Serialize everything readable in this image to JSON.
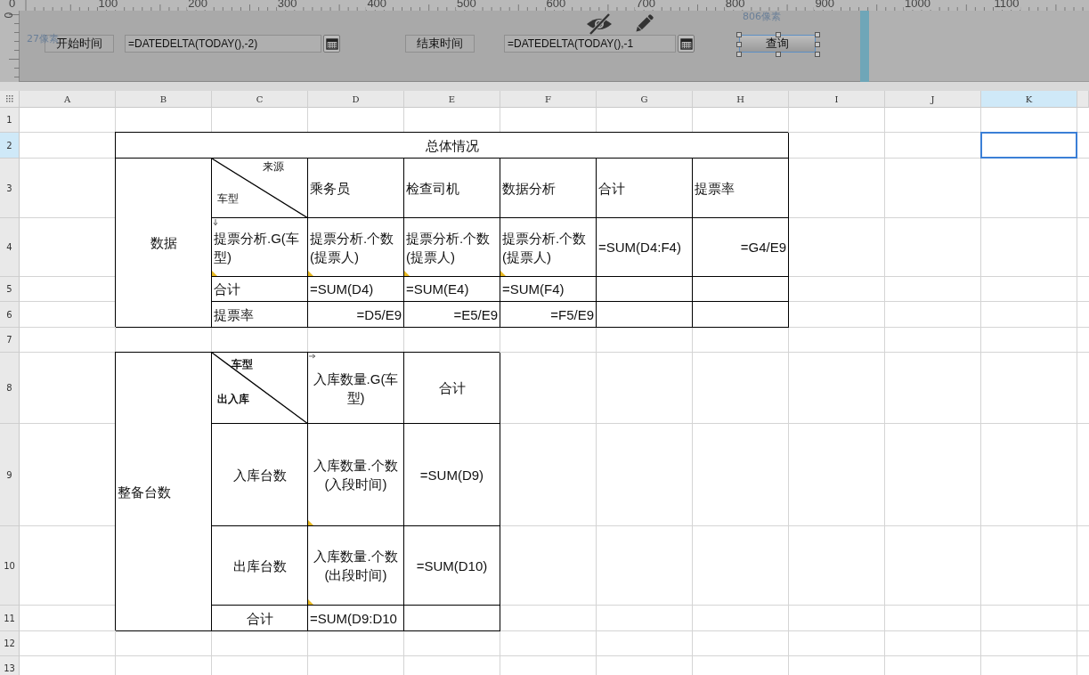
{
  "ruler": {
    "top_marks": [
      "0",
      "100",
      "200",
      "300",
      "400",
      "500",
      "600",
      "700",
      "800",
      "900",
      "1000",
      "1100"
    ],
    "left_mark": "0"
  },
  "parameter_panel": {
    "hints": [
      "27像素",
      "806像素"
    ],
    "widgets": [
      {
        "kind": "label",
        "text": "开始时间"
      },
      {
        "kind": "date",
        "value": "=DATEDELTA(TODAY(),-2)"
      },
      {
        "kind": "label",
        "text": "结束时间"
      },
      {
        "kind": "date",
        "value": "=DATEDELTA(TODAY(),-1"
      },
      {
        "kind": "button",
        "text": "查询",
        "selected": true
      }
    ]
  },
  "sheet": {
    "columns": [
      {
        "label": "A",
        "selected": false
      },
      {
        "label": "B",
        "selected": false
      },
      {
        "label": "C",
        "selected": false
      },
      {
        "label": "D",
        "selected": false
      },
      {
        "label": "E",
        "selected": false
      },
      {
        "label": "F",
        "selected": false
      },
      {
        "label": "G",
        "selected": false
      },
      {
        "label": "H",
        "selected": false
      },
      {
        "label": "I",
        "selected": false
      },
      {
        "label": "J",
        "selected": false
      },
      {
        "label": "K",
        "selected": true
      }
    ],
    "rows": [
      {
        "label": "1",
        "selected": false
      },
      {
        "label": "2",
        "selected": true
      },
      {
        "label": "3",
        "selected": false
      },
      {
        "label": "4",
        "selected": false
      },
      {
        "label": "5",
        "selected": false
      },
      {
        "label": "6",
        "selected": false
      },
      {
        "label": "7",
        "selected": false
      },
      {
        "label": "8",
        "selected": false
      },
      {
        "label": "9",
        "selected": false
      },
      {
        "label": "10",
        "selected": false
      },
      {
        "label": "11",
        "selected": false
      },
      {
        "label": "12",
        "selected": false
      },
      {
        "label": "13",
        "selected": false
      }
    ],
    "cells": [
      {
        "kind": "text",
        "text": "总体情况"
      },
      {
        "kind": "text",
        "text": "数据"
      },
      {
        "kind": "diagonal",
        "top": "来源",
        "bottom": "车型",
        "bold": false
      },
      {
        "kind": "text",
        "text": "乘务员"
      },
      {
        "kind": "text",
        "text": "检查司机"
      },
      {
        "kind": "text",
        "text": "数据分析"
      },
      {
        "kind": "text",
        "text": "合计"
      },
      {
        "kind": "text",
        "text": "提票率"
      },
      {
        "kind": "text",
        "text": "提票分析.G(车型)",
        "marker": true,
        "expand_down": true
      },
      {
        "kind": "text",
        "text": "提票分析.个数(提票人)",
        "marker": true
      },
      {
        "kind": "text",
        "text": "提票分析.个数(提票人)",
        "marker": true
      },
      {
        "kind": "text",
        "text": "提票分析.个数(提票人)",
        "marker": true
      },
      {
        "kind": "text",
        "text": "=SUM(D4:F4)"
      },
      {
        "kind": "text",
        "text": "=G4/E9"
      },
      {
        "kind": "text",
        "text": "合计"
      },
      {
        "kind": "text",
        "text": "=SUM(D4)"
      },
      {
        "kind": "text",
        "text": "=SUM(E4)"
      },
      {
        "kind": "text",
        "text": "=SUM(F4)"
      },
      {
        "kind": "empty"
      },
      {
        "kind": "empty"
      },
      {
        "kind": "text",
        "text": "提票率"
      },
      {
        "kind": "text",
        "text": "=D5/E9"
      },
      {
        "kind": "text",
        "text": "=E5/E9"
      },
      {
        "kind": "text",
        "text": "=F5/E9"
      },
      {
        "kind": "empty"
      },
      {
        "kind": "empty"
      },
      {
        "kind": "text",
        "text": "整备台数"
      },
      {
        "kind": "diagonal",
        "top": "车型",
        "bottom": "出入库",
        "bold": true
      },
      {
        "kind": "text",
        "text": "入库数量.G(车型)",
        "expand_right": true
      },
      {
        "kind": "text",
        "text": "合计"
      },
      {
        "kind": "text",
        "text": "入库台数"
      },
      {
        "kind": "text",
        "text": "入库数量.个数(入段时间)",
        "marker": true
      },
      {
        "kind": "text",
        "text": "=SUM(D9)"
      },
      {
        "kind": "text",
        "text": "出库台数"
      },
      {
        "kind": "text",
        "text": "入库数量.个数(出段时间)",
        "marker": true
      },
      {
        "kind": "text",
        "text": "=SUM(D10)"
      },
      {
        "kind": "text",
        "text": "合计"
      },
      {
        "kind": "text",
        "text": "=SUM(D9:D10"
      },
      {
        "kind": "empty"
      }
    ]
  }
}
